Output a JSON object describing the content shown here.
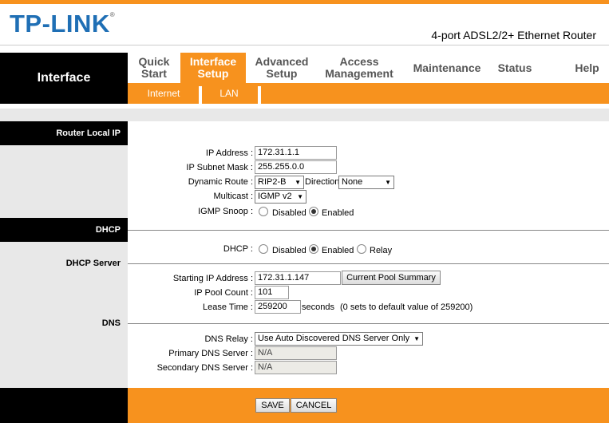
{
  "header": {
    "logo": "TP-LINK",
    "logo_mark": "®",
    "product": "4-port ADSL2/2+ Ethernet Router"
  },
  "nav": {
    "section": "Interface",
    "items": [
      {
        "line1": "Quick",
        "line2": "Start"
      },
      {
        "line1": "Interface",
        "line2": "Setup"
      },
      {
        "line1": "Advanced",
        "line2": "Setup"
      },
      {
        "line1": "Access",
        "line2": "Management"
      },
      {
        "line1": "Maintenance",
        "line2": ""
      },
      {
        "line1": "Status",
        "line2": ""
      },
      {
        "line1": "Help",
        "line2": ""
      }
    ],
    "sub": [
      "Internet",
      "LAN"
    ]
  },
  "router_local_ip": {
    "section_label": "Router Local IP",
    "ip_address_label": "IP Address :",
    "ip_address": "172.31.1.1",
    "subnet_label": "IP Subnet Mask :",
    "subnet": "255.255.0.0",
    "dynamic_route_label": "Dynamic Route :",
    "dynamic_route": "RIP2-B",
    "direction_label": "Direction",
    "direction": "None",
    "multicast_label": "Multicast :",
    "multicast": "IGMP v2",
    "igmp_snoop_label": "IGMP Snoop :",
    "igmp_disabled": "Disabled",
    "igmp_enabled": "Enabled"
  },
  "dhcp": {
    "section_label": "DHCP",
    "dhcp_label": "DHCP :",
    "opt_disabled": "Disabled",
    "opt_enabled": "Enabled",
    "opt_relay": "Relay",
    "server_label": "DHCP Server",
    "start_ip_label": "Starting IP Address :",
    "start_ip": "172.31.1.147",
    "pool_summary_button": "Current Pool Summary",
    "pool_count_label": "IP Pool Count :",
    "pool_count": "101",
    "lease_time_label": "Lease Time :",
    "lease_time": "259200",
    "lease_unit": "seconds",
    "lease_note": "(0 sets to default value of 259200)"
  },
  "dns": {
    "section_label": "DNS",
    "relay_label": "DNS Relay :",
    "relay": "Use Auto Discovered DNS Server Only",
    "primary_label": "Primary DNS Server :",
    "primary": "N/A",
    "secondary_label": "Secondary DNS Server :",
    "secondary": "N/A"
  },
  "footer": {
    "save": "SAVE",
    "cancel": "CANCEL"
  },
  "colors": {
    "accent": "#f7921e",
    "logo": "#1f6fb5"
  }
}
